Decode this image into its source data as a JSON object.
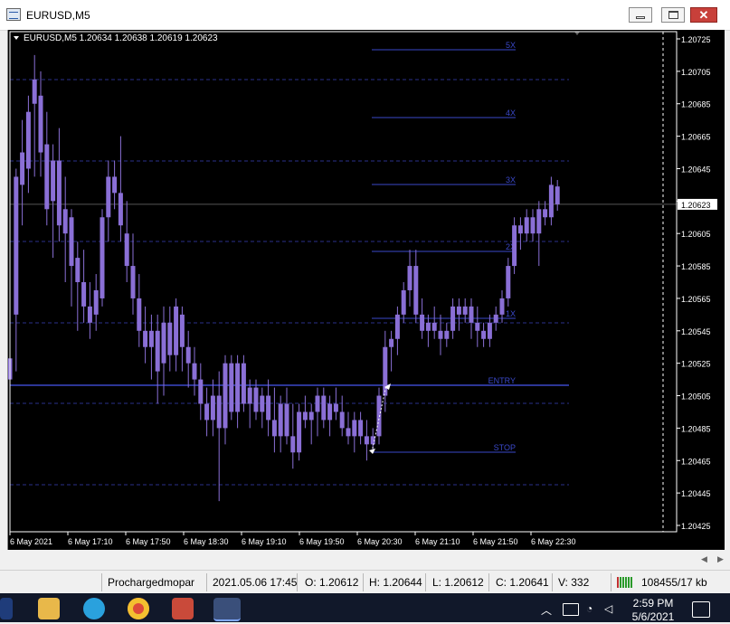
{
  "window": {
    "title": "EURUSD,M5"
  },
  "chart": {
    "header": "EURUSD,M5  1.20634 1.20638 1.20619 1.20623",
    "current_price": "1.20623",
    "price_axis": [
      "1.20725",
      "1.20705",
      "1.20685",
      "1.20665",
      "1.20645",
      "1.20625",
      "1.20605",
      "1.20585",
      "1.20565",
      "1.20545",
      "1.20525",
      "1.20505",
      "1.20485",
      "1.20465",
      "1.20445",
      "1.20425"
    ],
    "time_axis": [
      "6 May 2021",
      "6 May 17:10",
      "6 May 17:50",
      "6 May 18:30",
      "6 May 19:10",
      "6 May 19:50",
      "6 May 20:30",
      "6 May 21:10",
      "6 May 21:50",
      "6 May 22:30"
    ],
    "levels": [
      "5X",
      "4X",
      "3X",
      "2X",
      "1X",
      "ENTRY",
      "STOP"
    ],
    "colors": {
      "background": "#000000",
      "candle": "#8a6fd6",
      "level_line": "#3a48c8",
      "grid": "#2a2f8a",
      "axis_text": "#ffffff"
    },
    "candles": [
      [
        1.20515,
        1.20535,
        1.20475,
        1.20528
      ],
      [
        1.20555,
        1.20645,
        1.2052,
        1.2064
      ],
      [
        1.20635,
        1.20675,
        1.2061,
        1.20655
      ],
      [
        1.20645,
        1.2069,
        1.2063,
        1.2068
      ],
      [
        1.20685,
        1.20715,
        1.2064,
        1.207
      ],
      [
        1.2069,
        1.20705,
        1.2064,
        1.20655
      ],
      [
        1.2066,
        1.2068,
        1.2061,
        1.2062
      ],
      [
        1.20625,
        1.2066,
        1.2059,
        1.2065
      ],
      [
        1.2065,
        1.2067,
        1.206,
        1.2061
      ],
      [
        1.20605,
        1.2064,
        1.20575,
        1.2062
      ],
      [
        1.20615,
        1.2062,
        1.2056,
        1.20585
      ],
      [
        1.2059,
        1.206,
        1.20545,
        1.20575
      ],
      [
        1.20575,
        1.20595,
        1.2055,
        1.2056
      ],
      [
        1.2056,
        1.20575,
        1.2054,
        1.2055
      ],
      [
        1.20555,
        1.2058,
        1.20545,
        1.2057
      ],
      [
        1.20565,
        1.2062,
        1.2056,
        1.20615
      ],
      [
        1.20615,
        1.2065,
        1.206,
        1.2064
      ],
      [
        1.2064,
        1.2065,
        1.2062,
        1.2063
      ],
      [
        1.2063,
        1.20665,
        1.206,
        1.2061
      ],
      [
        1.20605,
        1.20625,
        1.20575,
        1.20585
      ],
      [
        1.20585,
        1.20605,
        1.20555,
        1.20565
      ],
      [
        1.20565,
        1.2058,
        1.20535,
        1.20545
      ],
      [
        1.20545,
        1.2056,
        1.20525,
        1.20535
      ],
      [
        1.20535,
        1.20555,
        1.20515,
        1.20545
      ],
      [
        1.20545,
        1.20555,
        1.205,
        1.2052
      ],
      [
        1.20525,
        1.2056,
        1.20505,
        1.2055
      ],
      [
        1.2055,
        1.2056,
        1.2052,
        1.2053
      ],
      [
        1.2053,
        1.20565,
        1.2052,
        1.2056
      ],
      [
        1.20555,
        1.2056,
        1.2052,
        1.20535
      ],
      [
        1.20535,
        1.20545,
        1.2051,
        1.20525
      ],
      [
        1.20525,
        1.20535,
        1.20505,
        1.20515
      ],
      [
        1.20515,
        1.20525,
        1.2049,
        1.205
      ],
      [
        1.205,
        1.2051,
        1.2048,
        1.2049
      ],
      [
        1.2049,
        1.20515,
        1.2048,
        1.20505
      ],
      [
        1.20505,
        1.2052,
        1.2044,
        1.20485
      ],
      [
        1.20485,
        1.2053,
        1.20475,
        1.20525
      ],
      [
        1.20525,
        1.2053,
        1.2049,
        1.20495
      ],
      [
        1.20495,
        1.2053,
        1.20485,
        1.20525
      ],
      [
        1.20525,
        1.2053,
        1.20495,
        1.205
      ],
      [
        1.205,
        1.20515,
        1.20485,
        1.2051
      ],
      [
        1.2051,
        1.20515,
        1.2049,
        1.20495
      ],
      [
        1.20495,
        1.2051,
        1.20485,
        1.20505
      ],
      [
        1.20505,
        1.20515,
        1.2048,
        1.2049
      ],
      [
        1.2049,
        1.2051,
        1.2047,
        1.2048
      ],
      [
        1.2048,
        1.20505,
        1.2047,
        1.205
      ],
      [
        1.205,
        1.2051,
        1.20475,
        1.2048
      ],
      [
        1.2048,
        1.205,
        1.2046,
        1.2047
      ],
      [
        1.2047,
        1.205,
        1.20465,
        1.20495
      ],
      [
        1.20495,
        1.20505,
        1.20485,
        1.2049
      ],
      [
        1.2049,
        1.205,
        1.20475,
        1.20495
      ],
      [
        1.20495,
        1.2051,
        1.2048,
        1.20505
      ],
      [
        1.20505,
        1.2051,
        1.20485,
        1.2049
      ],
      [
        1.2049,
        1.20505,
        1.2048,
        1.205
      ],
      [
        1.205,
        1.2051,
        1.2049,
        1.20495
      ],
      [
        1.20495,
        1.20505,
        1.2048,
        1.20485
      ],
      [
        1.20485,
        1.20495,
        1.20475,
        1.2048
      ],
      [
        1.2048,
        1.20495,
        1.2047,
        1.2049
      ],
      [
        1.2049,
        1.20495,
        1.20475,
        1.2048
      ],
      [
        1.2048,
        1.2049,
        1.20465,
        1.20475
      ],
      [
        1.20475,
        1.20485,
        1.2047,
        1.2048
      ],
      [
        1.2048,
        1.2051,
        1.20475,
        1.20505
      ],
      [
        1.20505,
        1.20545,
        1.20495,
        1.20535
      ],
      [
        1.20535,
        1.20545,
        1.2052,
        1.2054
      ],
      [
        1.2054,
        1.2056,
        1.2053,
        1.20555
      ],
      [
        1.20555,
        1.20575,
        1.2055,
        1.2057
      ],
      [
        1.2057,
        1.20595,
        1.2056,
        1.20585
      ],
      [
        1.20585,
        1.20595,
        1.2055,
        1.20555
      ],
      [
        1.20555,
        1.20565,
        1.2054,
        1.20545
      ],
      [
        1.20545,
        1.20555,
        1.20535,
        1.2055
      ],
      [
        1.2055,
        1.2056,
        1.2054,
        1.20545
      ],
      [
        1.20545,
        1.20555,
        1.2053,
        1.2054
      ],
      [
        1.2054,
        1.2055,
        1.20535,
        1.20545
      ],
      [
        1.20545,
        1.20565,
        1.2054,
        1.2056
      ],
      [
        1.2056,
        1.20565,
        1.20545,
        1.20555
      ],
      [
        1.20555,
        1.20565,
        1.2055,
        1.2056
      ],
      [
        1.2056,
        1.20565,
        1.2054,
        1.2055
      ],
      [
        1.2055,
        1.2056,
        1.20535,
        1.20545
      ],
      [
        1.20545,
        1.2055,
        1.20535,
        1.2054
      ],
      [
        1.2054,
        1.20555,
        1.20535,
        1.2055
      ],
      [
        1.2055,
        1.2056,
        1.20545,
        1.20555
      ],
      [
        1.20555,
        1.2057,
        1.2055,
        1.20565
      ],
      [
        1.20565,
        1.2059,
        1.2056,
        1.20585
      ],
      [
        1.20585,
        1.20615,
        1.2058,
        1.2061
      ],
      [
        1.2061,
        1.20615,
        1.20595,
        1.20605
      ],
      [
        1.20605,
        1.2062,
        1.206,
        1.20615
      ],
      [
        1.20615,
        1.2062,
        1.206,
        1.20605
      ],
      [
        1.20605,
        1.20625,
        1.20585,
        1.2062
      ],
      [
        1.2062,
        1.20625,
        1.2061,
        1.20615
      ],
      [
        1.20615,
        1.2064,
        1.2061,
        1.20635
      ],
      [
        1.20634,
        1.20638,
        1.20619,
        1.20623
      ]
    ]
  },
  "status": {
    "profile": "Prochargedmopar",
    "datetime": "2021.05.06 17:45",
    "open": "O: 1.20612",
    "high": "H: 1.20644",
    "low": "L: 1.20612",
    "close": "C: 1.20641",
    "volume": "V: 332",
    "traffic": "108455/17 kb"
  },
  "taskbar": {
    "time": "2:59 PM",
    "date": "5/6/2021"
  }
}
